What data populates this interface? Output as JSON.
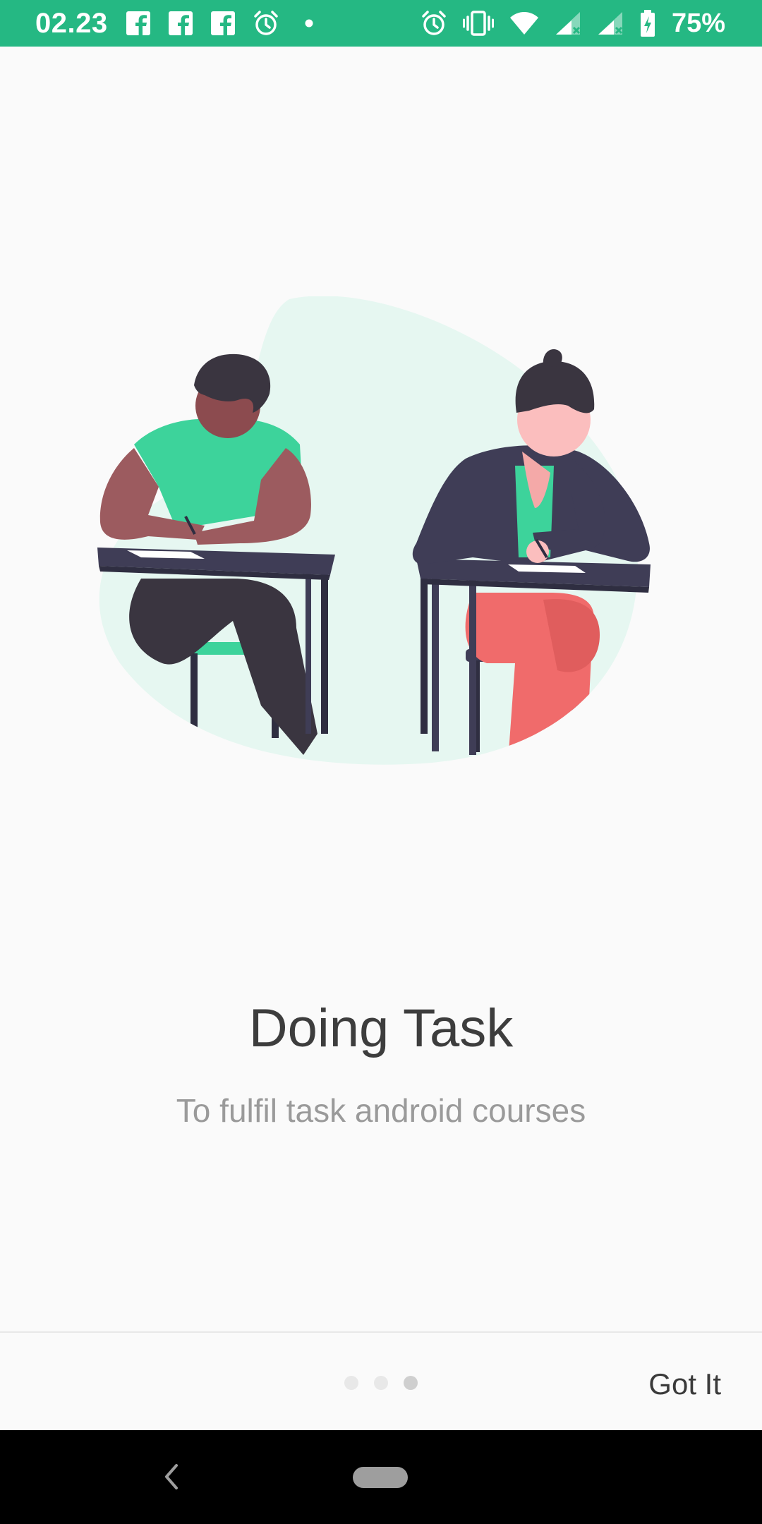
{
  "status_bar": {
    "time": "02.23",
    "battery_percent": "75%",
    "left_icons": [
      "facebook-icon",
      "facebook-icon",
      "facebook-icon",
      "alarm-clock-icon",
      "notification-dot-icon"
    ],
    "right_icons": [
      "alarm-clock-icon",
      "vibrate-icon",
      "wifi-icon",
      "signal-icon",
      "signal-icon",
      "battery-charging-icon"
    ],
    "background_color": "#25b883"
  },
  "onboarding": {
    "title": "Doing Task",
    "subtitle": "To fulfil task android courses",
    "illustration": "two-students-writing-at-desks",
    "accent_color": "#3dd39b",
    "pages_total": 3,
    "current_page": 3
  },
  "footer": {
    "got_it_label": "Got It"
  },
  "nav_bar": {
    "icons": [
      "back-icon",
      "home-pill-icon"
    ]
  }
}
